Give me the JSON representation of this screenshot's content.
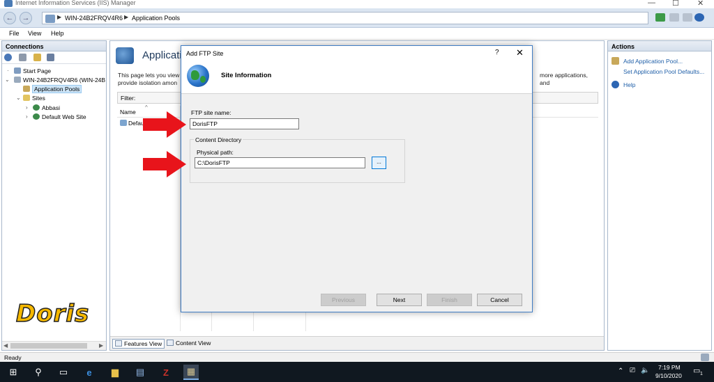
{
  "window": {
    "title": "Internet Information Services (IIS) Manager",
    "controls": [
      "—",
      "☐",
      "✕"
    ]
  },
  "address": {
    "crumbs": [
      "WIN-24B2FRQV4R6",
      "Application Pools"
    ]
  },
  "menu": [
    "File",
    "View",
    "Help"
  ],
  "connections": {
    "header": "Connections",
    "tree": [
      {
        "label": "Start Page"
      },
      {
        "label": "WIN-24B2FRQV4R6 (WIN-24B"
      },
      {
        "label": "Application Pools"
      },
      {
        "label": "Sites"
      },
      {
        "label": "Abbasi"
      },
      {
        "label": "Default Web Site"
      }
    ]
  },
  "logo_text": "Doris",
  "center": {
    "title": "Applicati",
    "desc_line1": "This page lets you view",
    "desc_line1_right": "more applications, and",
    "desc_line2": "provide isolation amon",
    "filter_label": "Filter:",
    "col_name": "Name",
    "row1": "Defau",
    "tab_features": "Features View",
    "tab_content": "Content View"
  },
  "actions": {
    "header": "Actions",
    "items": [
      "Add Application Pool...",
      "Set Application Pool Defaults...",
      "Help"
    ]
  },
  "status": "Ready",
  "dialog": {
    "title": "Add FTP Site",
    "help": "?",
    "close": "✕",
    "heading": "Site Information",
    "site_name_label": "FTP site name:",
    "site_name_value": "DorisFTP",
    "content_dir_label": "Content Directory",
    "physical_path_label": "Physical path:",
    "physical_path_value": "C:\\DorisFTP",
    "browse_label": "...",
    "buttons": {
      "previous": "Previous",
      "next": "Next",
      "finish": "Finish",
      "cancel": "Cancel"
    }
  },
  "taskbar": {
    "time": "7:19 PM",
    "date": "9/10/2020",
    "notification_count": "1"
  },
  "colors": {
    "accent": "#0078d7",
    "arrow": "#e8141b",
    "logo": "#f5b800"
  }
}
